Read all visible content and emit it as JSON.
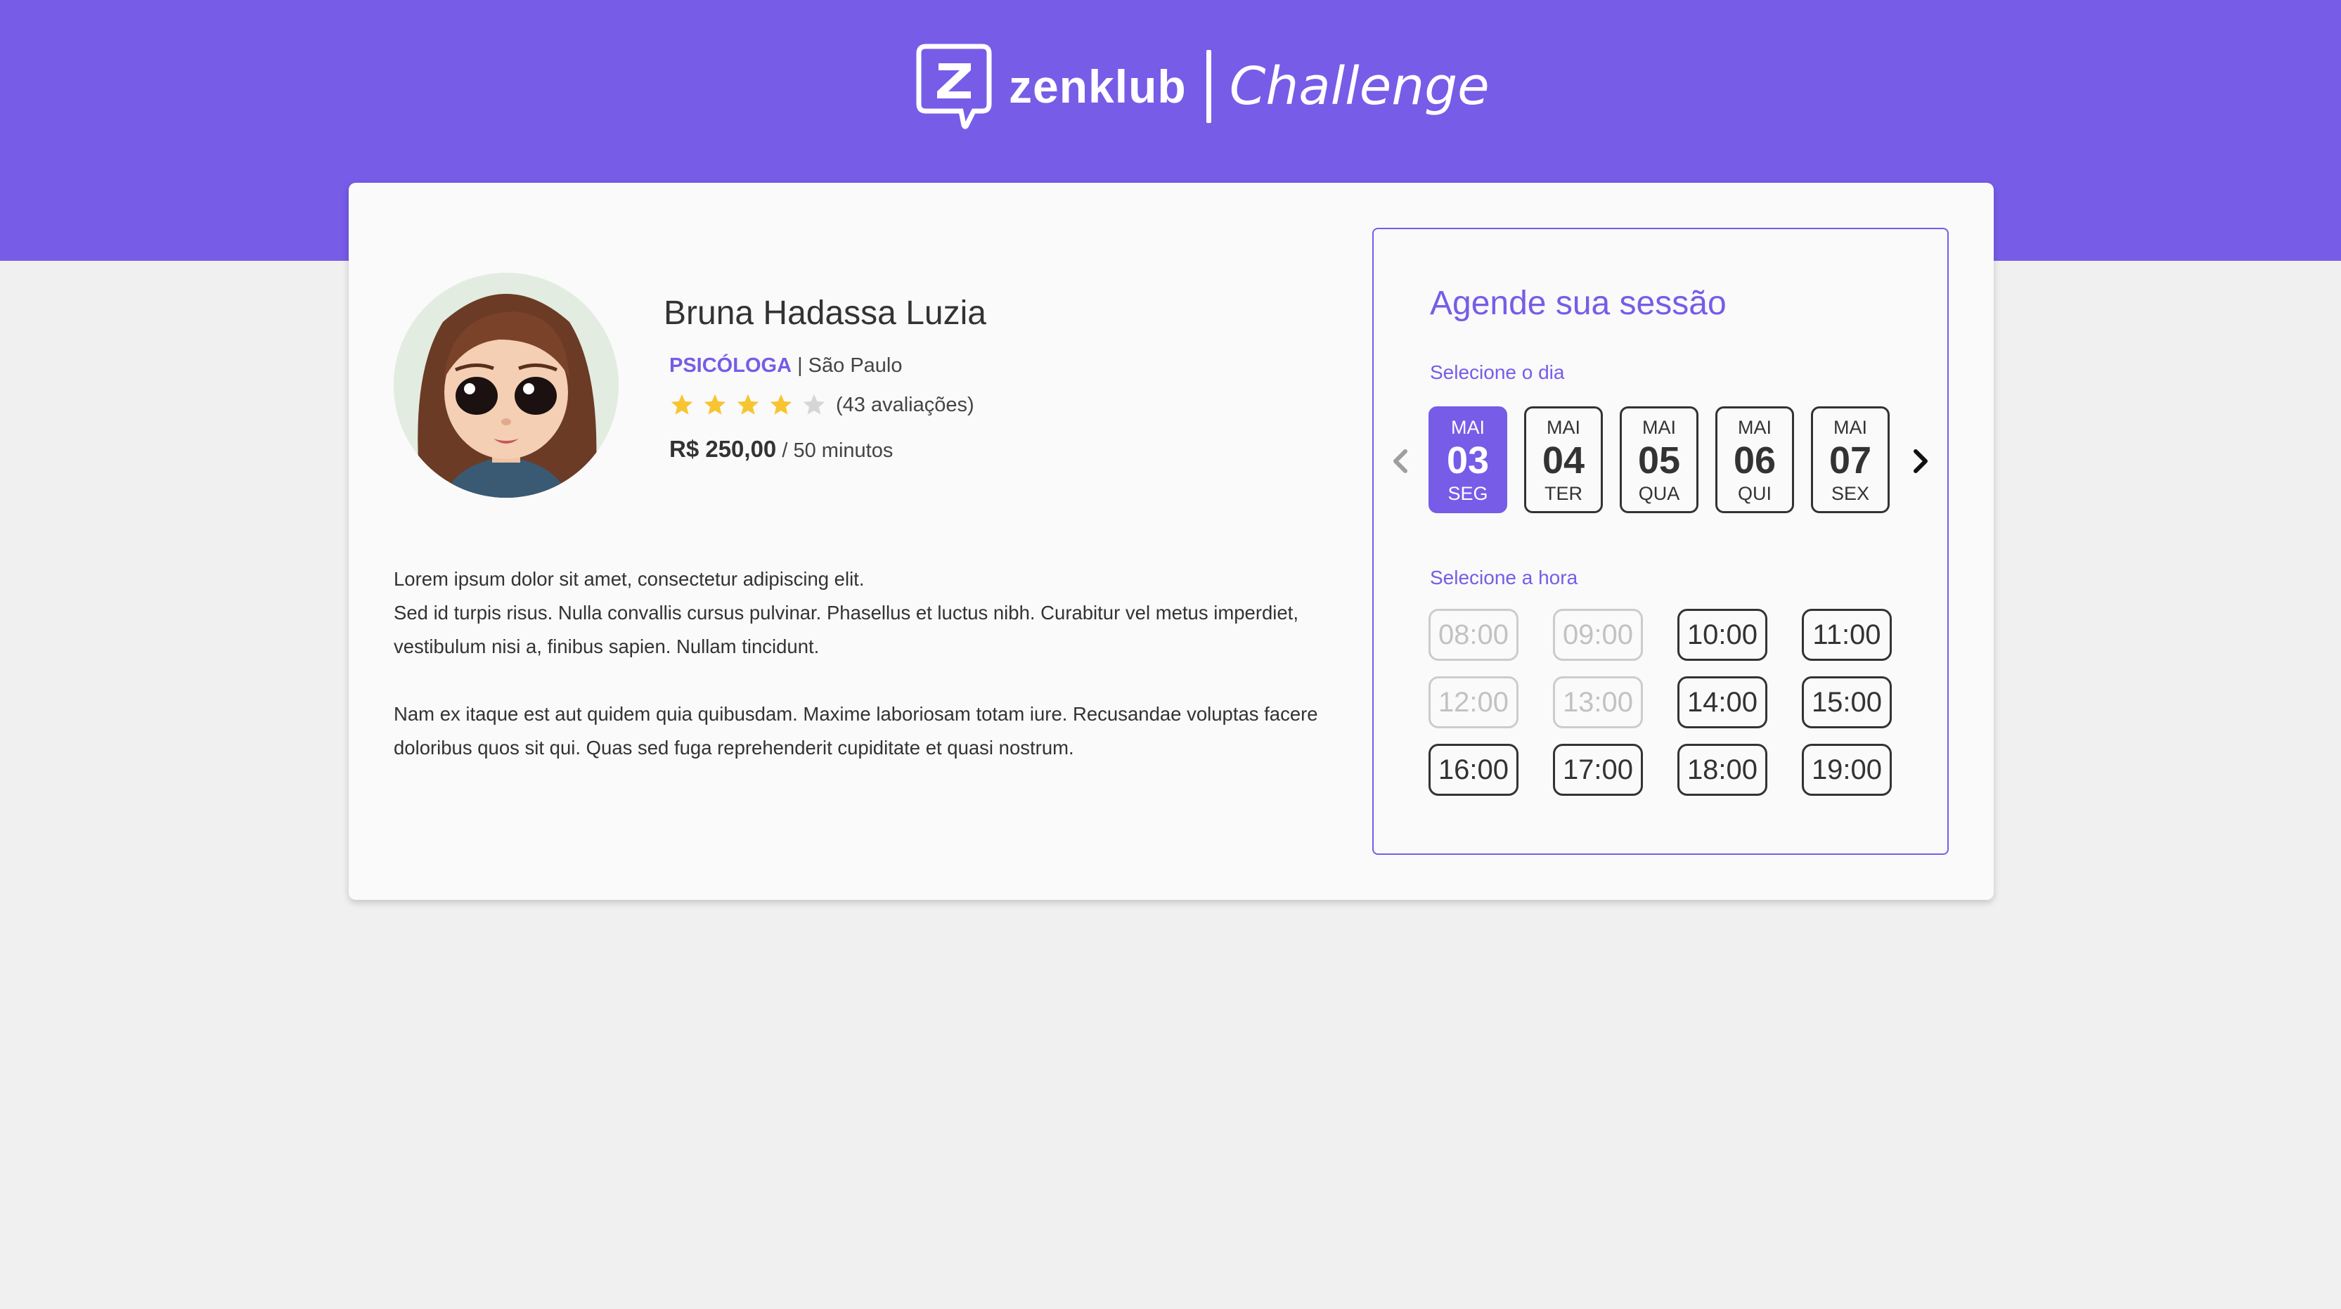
{
  "brand": {
    "name": "zenklub",
    "tagline": "Challenge",
    "primary_color": "#775ce7"
  },
  "profile": {
    "name": "Bruna Hadassa Luzia",
    "role": "PSICÓLOGA",
    "location_separator": " | ",
    "location": "São Paulo",
    "rating": 4,
    "rating_max": 5,
    "reviews_label": "(43 avaliações)",
    "price": "R$ 250,00",
    "duration": " / 50 minutos",
    "avatar_icon": "cartoon-girl-avatar"
  },
  "description": {
    "paragraph1_line1": "Lorem ipsum dolor sit amet, consectetur adipiscing elit.",
    "paragraph1_line2": "Sed id turpis risus. Nulla convallis cursus pulvinar. Phasellus et luctus nibh. Curabitur vel metus imperdiet, vestibulum nisi a, finibus sapien. Nullam tincidunt.",
    "paragraph2": "Nam ex itaque est aut quidem quia quibusdam. Maxime laboriosam totam iure. Recusandae voluptas facere doloribus quos sit qui. Quas sed fuga reprehenderit cupiditate et quasi nostrum."
  },
  "scheduler": {
    "title": "Agende sua sessão",
    "day_label": "Selecione o dia",
    "time_label": "Selecione a hora",
    "prev_icon": "chevron-left-icon",
    "next_icon": "chevron-right-icon",
    "days": [
      {
        "month": "MAI",
        "date": "03",
        "weekday": "SEG",
        "selected": true
      },
      {
        "month": "MAI",
        "date": "04",
        "weekday": "TER",
        "selected": false
      },
      {
        "month": "MAI",
        "date": "05",
        "weekday": "QUA",
        "selected": false
      },
      {
        "month": "MAI",
        "date": "06",
        "weekday": "QUI",
        "selected": false
      },
      {
        "month": "MAI",
        "date": "07",
        "weekday": "SEX",
        "selected": false
      }
    ],
    "times": [
      {
        "label": "08:00",
        "available": false
      },
      {
        "label": "09:00",
        "available": false
      },
      {
        "label": "10:00",
        "available": true
      },
      {
        "label": "11:00",
        "available": true
      },
      {
        "label": "12:00",
        "available": false
      },
      {
        "label": "13:00",
        "available": false
      },
      {
        "label": "14:00",
        "available": true
      },
      {
        "label": "15:00",
        "available": true
      },
      {
        "label": "16:00",
        "available": true
      },
      {
        "label": "17:00",
        "available": true
      },
      {
        "label": "18:00",
        "available": true
      },
      {
        "label": "19:00",
        "available": true
      }
    ]
  },
  "colors": {
    "accent": "#775ce7",
    "star_filled": "#f7c531",
    "star_empty": "#d6d6d6",
    "text": "#333333",
    "disabled": "#c2c2c2"
  }
}
